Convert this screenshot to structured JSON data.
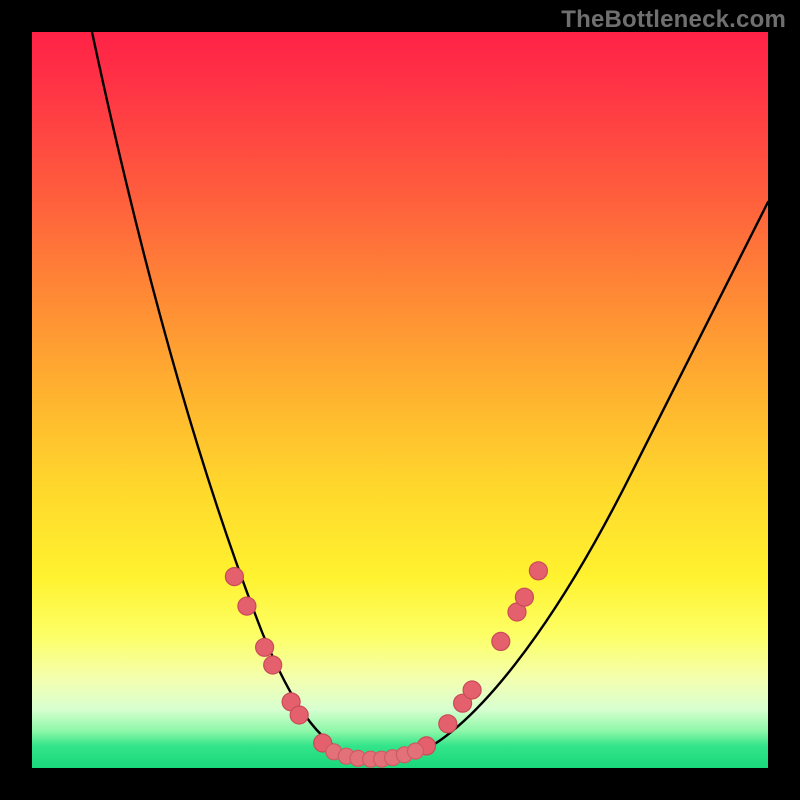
{
  "watermark": "TheBottleneck.com",
  "chart_data": {
    "type": "line",
    "title": "",
    "xlabel": "",
    "ylabel": "",
    "xlim": [
      0,
      100
    ],
    "ylim": [
      0,
      100
    ],
    "series": [
      {
        "name": "bottleneck-curve",
        "type": "path",
        "description": "Asymmetric V-shaped curve from top-left, dipping to a flat bottom near center-left, rising to upper right"
      }
    ],
    "left_markers_xy": [
      [
        27.5,
        26.0
      ],
      [
        29.2,
        22.0
      ],
      [
        31.6,
        16.4
      ],
      [
        32.7,
        14.0
      ],
      [
        35.2,
        9.0
      ],
      [
        36.3,
        7.2
      ],
      [
        39.5,
        3.4
      ]
    ],
    "right_markers_xy": [
      [
        53.6,
        3.0
      ],
      [
        56.5,
        6.0
      ],
      [
        58.5,
        8.8
      ],
      [
        59.8,
        10.6
      ],
      [
        63.7,
        17.2
      ],
      [
        65.9,
        21.2
      ],
      [
        66.9,
        23.2
      ],
      [
        68.8,
        26.8
      ]
    ],
    "flat_markers_xy": [
      [
        41.0,
        2.2
      ],
      [
        42.7,
        1.6
      ],
      [
        44.3,
        1.3
      ],
      [
        46.0,
        1.2
      ],
      [
        47.5,
        1.2
      ],
      [
        49.0,
        1.4
      ],
      [
        50.6,
        1.8
      ],
      [
        52.1,
        2.3
      ]
    ],
    "background_gradient": {
      "top": "#ff2247",
      "mid": "#ffd82c",
      "bottom": "#19d87b"
    }
  }
}
